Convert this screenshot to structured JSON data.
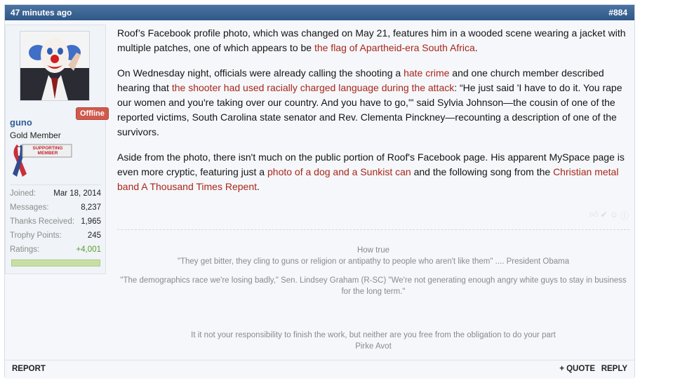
{
  "post": {
    "time": "47 minutes ago",
    "number": "#884"
  },
  "user": {
    "name": "guno",
    "title": "Gold Member",
    "status": "Offline",
    "badge_text": "SUPPORTING MEMBER",
    "stats": [
      {
        "label": "Joined:",
        "value": "Mar 18, 2014"
      },
      {
        "label": "Messages:",
        "value": "8,237"
      },
      {
        "label": "Thanks Received:",
        "value": "1,965"
      },
      {
        "label": "Trophy Points:",
        "value": "245"
      },
      {
        "label": "Ratings:",
        "value": "+4,001"
      }
    ],
    "rating_fraction": 1.0
  },
  "message": {
    "p1_a": "Roof’s Facebook profile photo, which was changed on May 21, features him in a wooded scene wearing a jacket with multiple patches, one of which appears to be ",
    "p1_link": "the flag of Apartheid-era South Africa",
    "p1_b": ".",
    "p2_a": "On Wednesday night, officials were already calling the shooting a ",
    "p2_link1": "hate crime",
    "p2_b": " and one church member described hearing that ",
    "p2_link2": "the shooter had used racially charged language during the attack",
    "p2_c": ": “He just said 'I have to do it. You rape our women and you're taking over our country. And you have to go,'\" said Sylvia Johnson—the cousin of one of the reported victims, South Carolina state senator and Rev. Clementa Pinckney—recounting a description of one of the survivors.",
    "p3_a": "Aside from the photo, there isn't much on the public portion of Roof's Facebook page. His apparent MySpace page is even more cryptic, featuring just a ",
    "p3_link1": "photo of a dog and a Sunkist can",
    "p3_b": " and the following song from the ",
    "p3_link2": "Christian metal band A Thousand Times Repent",
    "p3_c": "."
  },
  "signature": {
    "line1": "How true",
    "line2": "\"They get bitter, they cling to guns or religion or antipathy to people who aren't like them\" .... President Obama",
    "line3": "\"The demographics race we're losing badly,\" Sen. Lindsey Graham (R-SC) \"We're not generating enough angry white guys to stay in business for the long term.\"",
    "line4": "It it not your responsibility to finish the work, but neither are you free from the obligation to do your part",
    "line5": "Pirke Avot"
  },
  "footer": {
    "report": "REPORT",
    "quote": "+ QUOTE",
    "reply": "REPLY"
  },
  "colors": {
    "header": "#3d6697",
    "link": "#a8261b",
    "username": "#2f5f96",
    "offline": "#d05a4e",
    "rating_positive": "#5b9a2f"
  },
  "icons": [
    "thumbs-up-icon",
    "check-icon",
    "smile-icon",
    "info-icon"
  ]
}
